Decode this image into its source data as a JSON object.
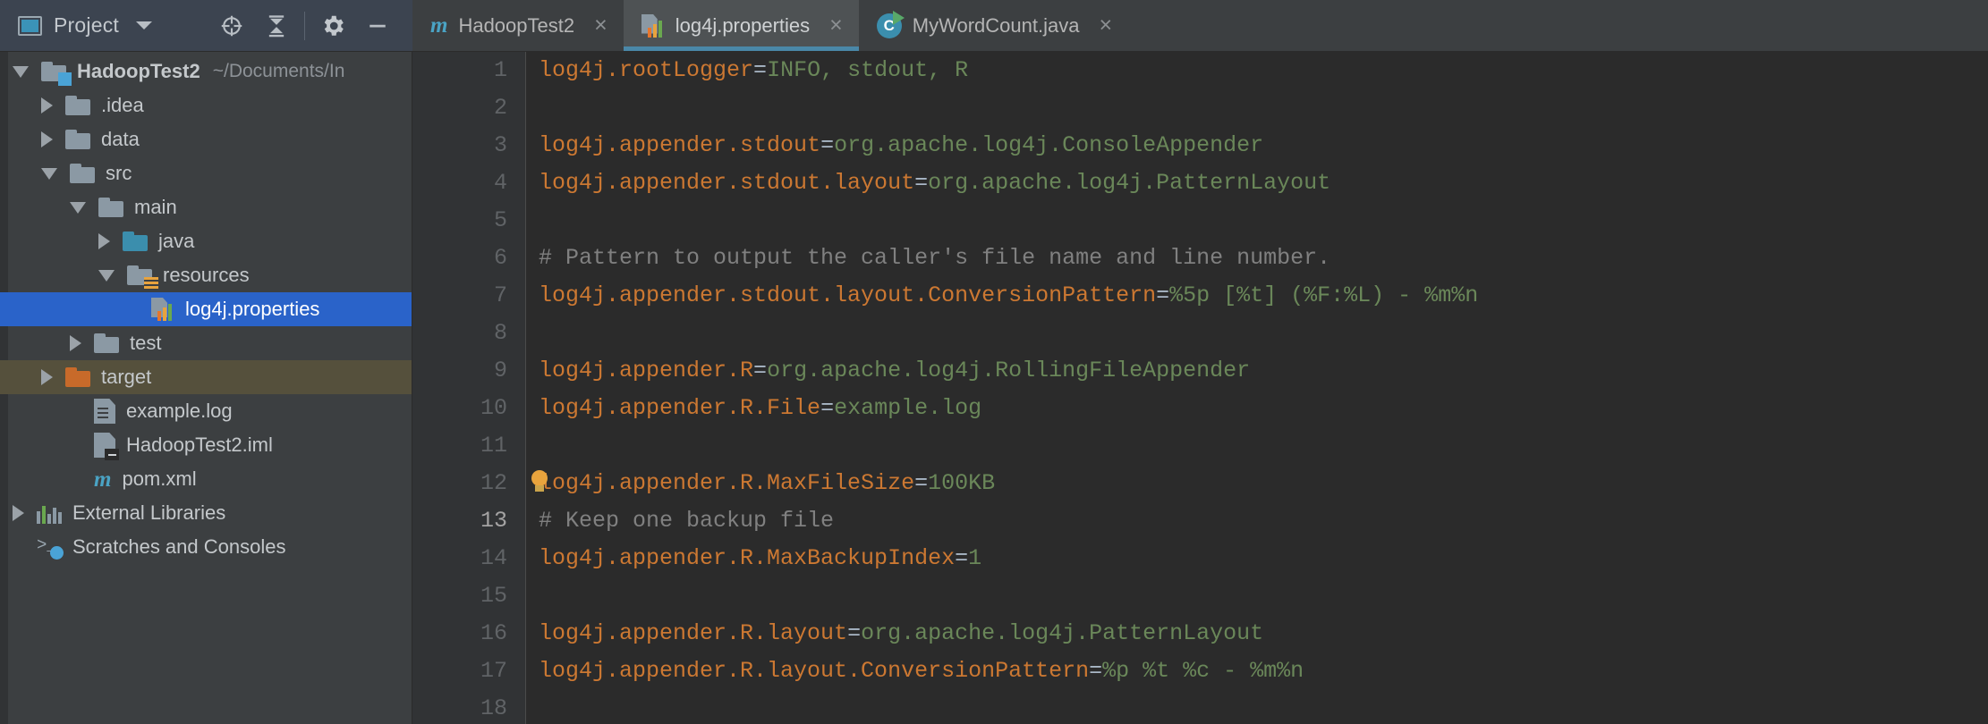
{
  "project_toolbar": {
    "title": "Project",
    "icons": [
      {
        "name": "project-view-icon"
      },
      {
        "name": "chevron-down-icon"
      },
      {
        "name": "locate-target-icon"
      },
      {
        "name": "collapse-all-icon"
      },
      {
        "name": "gear-icon"
      },
      {
        "name": "minimize-icon"
      }
    ]
  },
  "tabs": [
    {
      "label": "HadoopTest2",
      "icon": "maven-icon",
      "active": false,
      "close": "×"
    },
    {
      "label": "log4j.properties",
      "icon": "properties-file-icon",
      "active": true,
      "close": "×"
    },
    {
      "label": "MyWordCount.java",
      "icon": "java-class-runnable-icon",
      "active": false,
      "close": "×"
    }
  ],
  "tree": [
    {
      "label": "HadoopTest2",
      "path": "~/Documents/In",
      "indent": 0,
      "arrow": "down",
      "icon": "folder-module",
      "bold": true,
      "state": "normal"
    },
    {
      "label": ".idea",
      "path": "",
      "indent": 1,
      "arrow": "right",
      "icon": "folder",
      "bold": false,
      "state": "normal"
    },
    {
      "label": "data",
      "path": "",
      "indent": 1,
      "arrow": "right",
      "icon": "folder",
      "bold": false,
      "state": "normal"
    },
    {
      "label": "src",
      "path": "",
      "indent": 1,
      "arrow": "down",
      "icon": "folder",
      "bold": false,
      "state": "normal"
    },
    {
      "label": "main",
      "path": "",
      "indent": 2,
      "arrow": "down",
      "icon": "folder",
      "bold": false,
      "state": "normal"
    },
    {
      "label": "java",
      "path": "",
      "indent": 3,
      "arrow": "right",
      "icon": "folder-sources",
      "bold": false,
      "state": "normal"
    },
    {
      "label": "resources",
      "path": "",
      "indent": 3,
      "arrow": "down",
      "icon": "folder-resources",
      "bold": false,
      "state": "normal"
    },
    {
      "label": "log4j.properties",
      "path": "",
      "indent": 4,
      "arrow": "none",
      "icon": "properties-file-icon",
      "bold": false,
      "state": "selected"
    },
    {
      "label": "test",
      "path": "",
      "indent": 2,
      "arrow": "right",
      "icon": "folder",
      "bold": false,
      "state": "normal"
    },
    {
      "label": "target",
      "path": "",
      "indent": 1,
      "arrow": "right",
      "icon": "folder-excluded",
      "bold": false,
      "state": "excluded"
    },
    {
      "label": "example.log",
      "path": "",
      "indent": 2,
      "arrow": "none",
      "icon": "text-file-icon",
      "bold": false,
      "state": "normal"
    },
    {
      "label": "HadoopTest2.iml",
      "path": "",
      "indent": 2,
      "arrow": "none",
      "icon": "iml-file-icon",
      "bold": false,
      "state": "normal"
    },
    {
      "label": "pom.xml",
      "path": "",
      "indent": 2,
      "arrow": "none",
      "icon": "maven-icon",
      "bold": false,
      "state": "normal"
    },
    {
      "label": "External Libraries",
      "path": "",
      "indent": 0,
      "arrow": "right",
      "icon": "library-icon",
      "bold": false,
      "state": "normal"
    },
    {
      "label": "Scratches and Consoles",
      "path": "",
      "indent": 0,
      "arrow": "none",
      "icon": "scratches-icon",
      "bold": false,
      "state": "normal"
    }
  ],
  "editor": {
    "current_line": 13,
    "bulb_line": 12,
    "lines": [
      {
        "n": 1,
        "segments": [
          {
            "t": "log4j.rootLogger",
            "c": "k"
          },
          {
            "t": "=",
            "c": "eq"
          },
          {
            "t": "INFO, stdout, R",
            "c": "v"
          }
        ]
      },
      {
        "n": 2,
        "segments": []
      },
      {
        "n": 3,
        "segments": [
          {
            "t": "log4j.appender.stdout",
            "c": "k"
          },
          {
            "t": "=",
            "c": "eq"
          },
          {
            "t": "org.apache.log4j.ConsoleAppender",
            "c": "v"
          }
        ]
      },
      {
        "n": 4,
        "segments": [
          {
            "t": "log4j.appender.stdout.layout",
            "c": "k"
          },
          {
            "t": "=",
            "c": "eq"
          },
          {
            "t": "org.apache.log4j.PatternLayout",
            "c": "v"
          }
        ]
      },
      {
        "n": 5,
        "segments": []
      },
      {
        "n": 6,
        "segments": [
          {
            "t": "# Pattern to output the caller's file name and line number.",
            "c": "cm"
          }
        ]
      },
      {
        "n": 7,
        "segments": [
          {
            "t": "log4j.appender.stdout.layout.ConversionPattern",
            "c": "k"
          },
          {
            "t": "=",
            "c": "eq"
          },
          {
            "t": "%5p [%t] (%F:%L) - %m%n",
            "c": "v"
          }
        ]
      },
      {
        "n": 8,
        "segments": []
      },
      {
        "n": 9,
        "segments": [
          {
            "t": "log4j.appender.R",
            "c": "k"
          },
          {
            "t": "=",
            "c": "eq"
          },
          {
            "t": "org.apache.log4j.RollingFileAppender",
            "c": "v"
          }
        ]
      },
      {
        "n": 10,
        "segments": [
          {
            "t": "log4j.appender.R.File",
            "c": "k"
          },
          {
            "t": "=",
            "c": "eq"
          },
          {
            "t": "example.log",
            "c": "v"
          }
        ]
      },
      {
        "n": 11,
        "segments": []
      },
      {
        "n": 12,
        "segments": [
          {
            "t": "log4j.appender.R.MaxFileSize",
            "c": "k"
          },
          {
            "t": "=",
            "c": "eq"
          },
          {
            "t": "100KB",
            "c": "v"
          }
        ]
      },
      {
        "n": 13,
        "segments": [
          {
            "t": "# Keep one backup file",
            "c": "cm"
          }
        ]
      },
      {
        "n": 14,
        "segments": [
          {
            "t": "log4j.appender.R.MaxBackupIndex",
            "c": "k"
          },
          {
            "t": "=",
            "c": "eq"
          },
          {
            "t": "1",
            "c": "v"
          }
        ]
      },
      {
        "n": 15,
        "segments": []
      },
      {
        "n": 16,
        "segments": [
          {
            "t": "log4j.appender.R.layout",
            "c": "k"
          },
          {
            "t": "=",
            "c": "eq"
          },
          {
            "t": "org.apache.log4j.PatternLayout",
            "c": "v"
          }
        ]
      },
      {
        "n": 17,
        "segments": [
          {
            "t": "log4j.appender.R.layout.ConversionPattern",
            "c": "k"
          },
          {
            "t": "=",
            "c": "eq"
          },
          {
            "t": "%p %t %c - %m%n",
            "c": "v"
          }
        ]
      },
      {
        "n": 18,
        "segments": []
      }
    ]
  },
  "colors": {
    "key": "#cc7832",
    "value": "#6a8759",
    "comment": "#808080",
    "selection": "#2a63c9",
    "excluded_row": "#55503c",
    "tab_underline": "#4a88a8"
  }
}
